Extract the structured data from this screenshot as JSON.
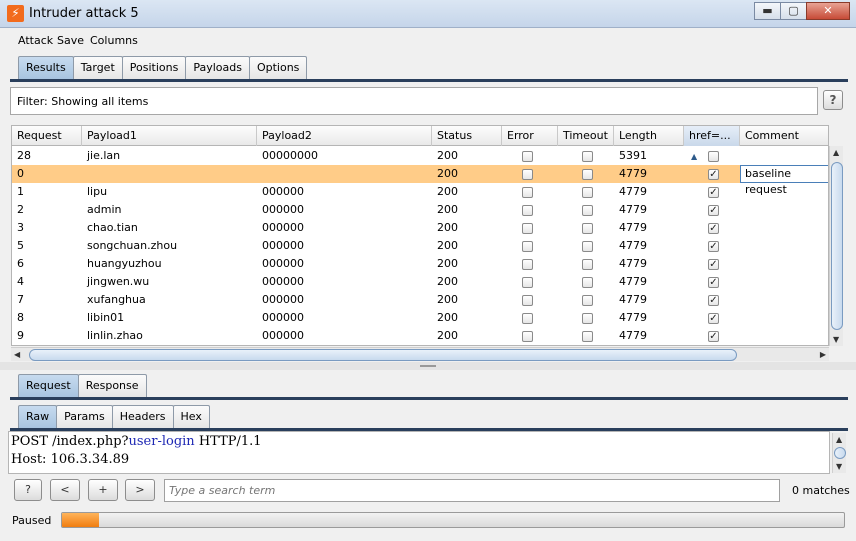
{
  "window": {
    "title": "Intruder attack 5",
    "app_icon": "burp-lightning-icon",
    "controls": [
      "minimize",
      "maximize",
      "close"
    ]
  },
  "menu": [
    "Attack",
    "Save",
    "Columns"
  ],
  "main_tabs": [
    {
      "label": "Results",
      "active": true
    },
    {
      "label": "Target",
      "active": false
    },
    {
      "label": "Positions",
      "active": false
    },
    {
      "label": "Payloads",
      "active": false
    },
    {
      "label": "Options",
      "active": false
    }
  ],
  "filter": {
    "text": "Filter:  Showing all items",
    "help": "?"
  },
  "table": {
    "columns": [
      "Request",
      "Payload1",
      "Payload2",
      "Status",
      "Error",
      "Timeout",
      "Length",
      "href=...",
      "Comment"
    ],
    "sort_indicator": "▲",
    "rows": [
      {
        "request": "28",
        "payload1": "jie.lan",
        "payload2": "00000000",
        "status": "200",
        "error": false,
        "timeout": false,
        "length": "5391",
        "href": false,
        "comment": "",
        "selected": false
      },
      {
        "request": "0",
        "payload1": "",
        "payload2": "",
        "status": "200",
        "error": false,
        "timeout": false,
        "length": "4779",
        "href": true,
        "comment": "baseline request",
        "selected": true
      },
      {
        "request": "1",
        "payload1": "lipu",
        "payload2": "000000",
        "status": "200",
        "error": false,
        "timeout": false,
        "length": "4779",
        "href": true,
        "comment": "",
        "selected": false
      },
      {
        "request": "2",
        "payload1": "admin",
        "payload2": "000000",
        "status": "200",
        "error": false,
        "timeout": false,
        "length": "4779",
        "href": true,
        "comment": "",
        "selected": false
      },
      {
        "request": "3",
        "payload1": "chao.tian",
        "payload2": "000000",
        "status": "200",
        "error": false,
        "timeout": false,
        "length": "4779",
        "href": true,
        "comment": "",
        "selected": false
      },
      {
        "request": "5",
        "payload1": "songchuan.zhou",
        "payload2": "000000",
        "status": "200",
        "error": false,
        "timeout": false,
        "length": "4779",
        "href": true,
        "comment": "",
        "selected": false
      },
      {
        "request": "6",
        "payload1": "huangyuzhou",
        "payload2": "000000",
        "status": "200",
        "error": false,
        "timeout": false,
        "length": "4779",
        "href": true,
        "comment": "",
        "selected": false
      },
      {
        "request": "4",
        "payload1": "jingwen.wu",
        "payload2": "000000",
        "status": "200",
        "error": false,
        "timeout": false,
        "length": "4779",
        "href": true,
        "comment": "",
        "selected": false
      },
      {
        "request": "7",
        "payload1": "xufanghua",
        "payload2": "000000",
        "status": "200",
        "error": false,
        "timeout": false,
        "length": "4779",
        "href": true,
        "comment": "",
        "selected": false
      },
      {
        "request": "8",
        "payload1": "libin01",
        "payload2": "000000",
        "status": "200",
        "error": false,
        "timeout": false,
        "length": "4779",
        "href": true,
        "comment": "",
        "selected": false
      },
      {
        "request": "9",
        "payload1": "linlin.zhao",
        "payload2": "000000",
        "status": "200",
        "error": false,
        "timeout": false,
        "length": "4779",
        "href": true,
        "comment": "",
        "selected": false
      }
    ]
  },
  "detail_tabs": [
    {
      "label": "Request",
      "active": true
    },
    {
      "label": "Response",
      "active": false
    }
  ],
  "view_tabs": [
    {
      "label": "Raw",
      "active": true
    },
    {
      "label": "Params",
      "active": false
    },
    {
      "label": "Headers",
      "active": false
    },
    {
      "label": "Hex",
      "active": false
    }
  ],
  "request": {
    "line1_prefix": "POST /index.php?",
    "line1_param": "user-login",
    "line1_suffix": " HTTP/1.1",
    "line2": "Host: 106.3.34.89"
  },
  "search_bar": {
    "help": "?",
    "prev": "<",
    "add": "+",
    "next": ">",
    "placeholder": "Type a search term",
    "matches": "0 matches"
  },
  "status": {
    "label": "Paused",
    "progress": 0.047
  },
  "colors": {
    "selected_row": "#ffcc88",
    "progress": "#f07d10",
    "highlight_param": "#1e28b4"
  }
}
